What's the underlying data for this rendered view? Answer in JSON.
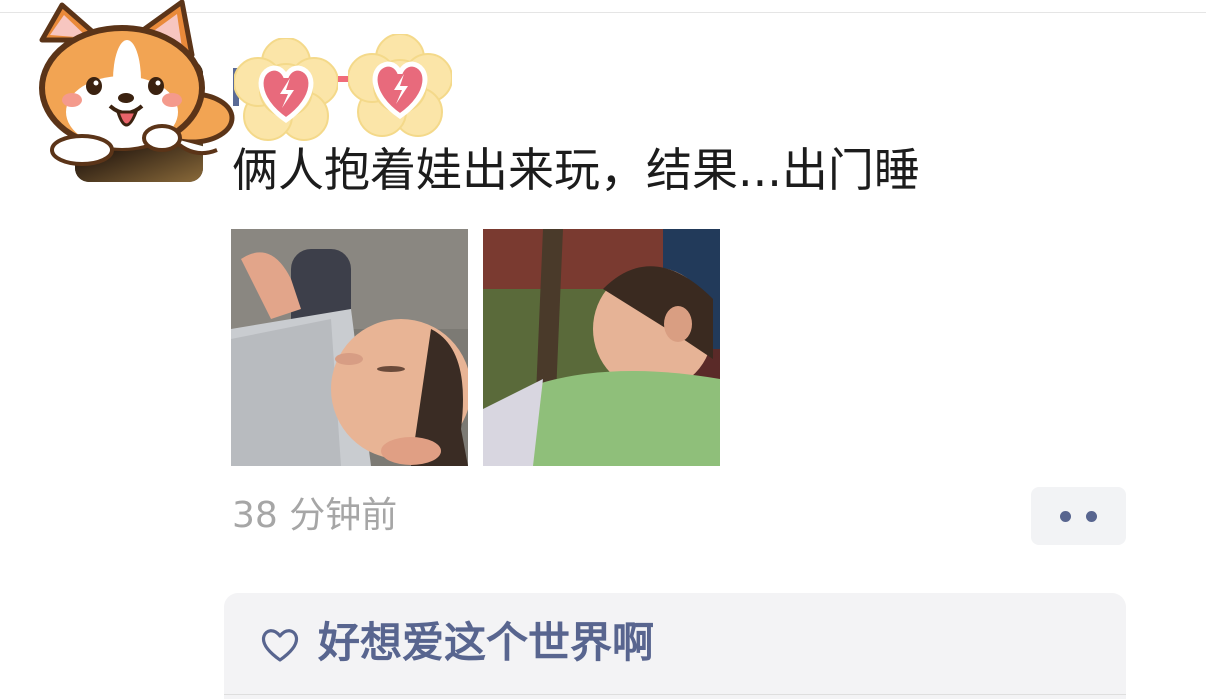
{
  "post": {
    "text": "俩人抱着娃出来玩，结果...出门睡",
    "timestamp": "38 分钟前",
    "images": [
      {
        "name": "baby-sleeping-photo-1"
      },
      {
        "name": "baby-sleeping-photo-2"
      }
    ]
  },
  "likes": {
    "users": "好想爱这个世界啊",
    "icon": "heart-outline-icon"
  },
  "stickers": {
    "avatar_overlay": "corgi-sticker",
    "name_overlay": "heart-flower-sticker"
  },
  "colors": {
    "link_blue": "#58658f",
    "timestamp_gray": "#a6a6a6",
    "panel_bg": "#f3f3f5",
    "text": "#1c1c1c"
  }
}
